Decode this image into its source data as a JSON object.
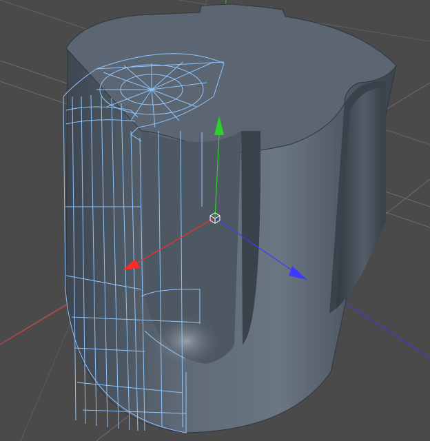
{
  "viewport": {
    "background": "#4a4a4a",
    "grid_color": "#6e6e6e",
    "mesh_fill": "#5d6874",
    "mesh_dark": "#3f4852",
    "wire_color": "#8fc6ff",
    "hud_text": ""
  },
  "gizmo": {
    "x_axis_color": "#ff2a2a",
    "y_axis_color": "#2ad12a",
    "z_axis_color": "#3b3bff",
    "handle_icon": "cube-handle-icon"
  }
}
